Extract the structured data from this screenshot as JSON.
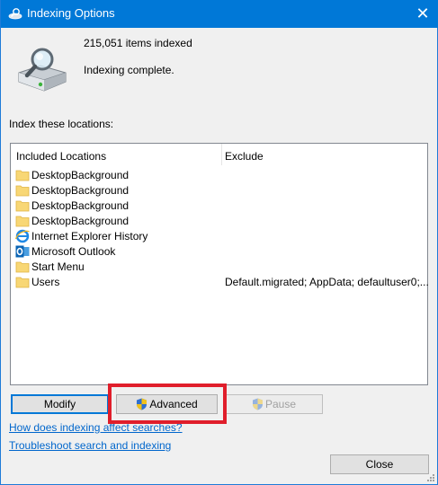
{
  "window": {
    "title": "Indexing Options",
    "close_glyph": "✕"
  },
  "status": {
    "items_count": "215,051 items indexed",
    "message": "Indexing complete."
  },
  "locations": {
    "section_label": "Index these locations:",
    "columns": {
      "included": "Included Locations",
      "exclude": "Exclude"
    },
    "rows": [
      {
        "icon": "folder-icon",
        "name": "DesktopBackground",
        "exclude": ""
      },
      {
        "icon": "folder-icon",
        "name": "DesktopBackground",
        "exclude": ""
      },
      {
        "icon": "folder-icon",
        "name": "DesktopBackground",
        "exclude": ""
      },
      {
        "icon": "folder-icon",
        "name": "DesktopBackground",
        "exclude": ""
      },
      {
        "icon": "internet-explorer-icon",
        "name": "Internet Explorer History",
        "exclude": ""
      },
      {
        "icon": "outlook-icon",
        "name": "Microsoft Outlook",
        "exclude": ""
      },
      {
        "icon": "folder-icon",
        "name": "Start Menu",
        "exclude": ""
      },
      {
        "icon": "folder-icon",
        "name": "Users",
        "exclude": "Default.migrated; AppData; defaultuser0;..."
      }
    ]
  },
  "buttons": {
    "modify": "Modify",
    "advanced": "Advanced",
    "pause": "Pause",
    "close": "Close"
  },
  "links": {
    "how_affect": "How does indexing affect searches?",
    "troubleshoot": "Troubleshoot search and indexing"
  },
  "colors": {
    "titlebar": "#0078d7",
    "highlight": "#e01e2b",
    "link": "#0066cc",
    "folder": "#f8d775"
  }
}
